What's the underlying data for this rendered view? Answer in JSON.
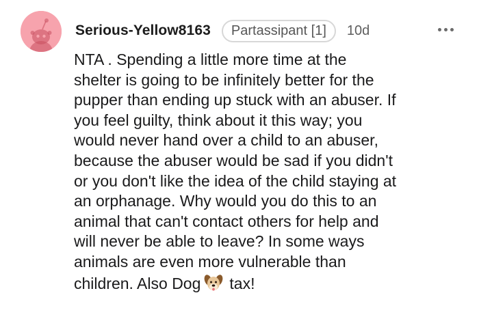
{
  "comment": {
    "author": "Serious-Yellow8163",
    "flair": "Partassipant [1]",
    "age": "10d",
    "avatar_color": "#f7a3ad",
    "more_icon": "more-options-icon",
    "body_lines": [
      "NTA . Spending a little more time at the",
      "shelter is going to be infinitely better for the",
      "pupper than ending up stuck with an abuser. If",
      "you feel guilty, think about it this way; you",
      "would never hand over a child to an abuser,",
      "because the abuser would be sad if you didn't",
      "or you don't like the idea of the child staying at",
      "an orphanage. Why would you do this to an",
      "animal that can't contact others for help and",
      "will never be able to leave? In some ways",
      "animals are even more vulnerable than"
    ],
    "last_line_before_emoji": "children. Also Dog",
    "emoji": "dog-face-emoji",
    "last_line_after_emoji": "tax!"
  }
}
